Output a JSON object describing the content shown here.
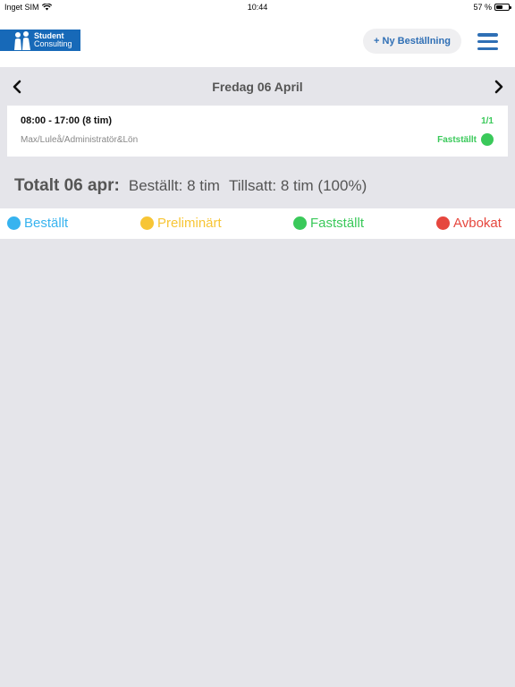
{
  "status_bar": {
    "carrier": "Inget SIM",
    "time": "10:44",
    "battery": "57 %",
    "battery_level": 0.57
  },
  "header": {
    "logo_line1": "Student",
    "logo_line2": "Consulting",
    "new_order_label": "+ Ny Beställning"
  },
  "date_nav": {
    "title": "Fredag 06 April"
  },
  "shift": {
    "time": "08:00 - 17:00  (8 tim)",
    "description": "Max/Luleå/Administratör&Lön",
    "count": "1/1",
    "status": "Fastställt"
  },
  "total": {
    "label": "Totalt 06 apr:",
    "ordered": "Beställt: 8 tim",
    "assigned": "Tillsatt: 8 tim (100%)"
  },
  "legend": [
    {
      "label": "Beställt",
      "color": "#37b3ef"
    },
    {
      "label": "Preliminärt",
      "color": "#f7c535"
    },
    {
      "label": "Fastställt",
      "color": "#3ac95a"
    },
    {
      "label": "Avbokat",
      "color": "#e6473e"
    }
  ],
  "colors": {
    "accent": "#2f6fb5",
    "logo_bg": "#1769b8",
    "confirmed": "#3ac95a"
  }
}
